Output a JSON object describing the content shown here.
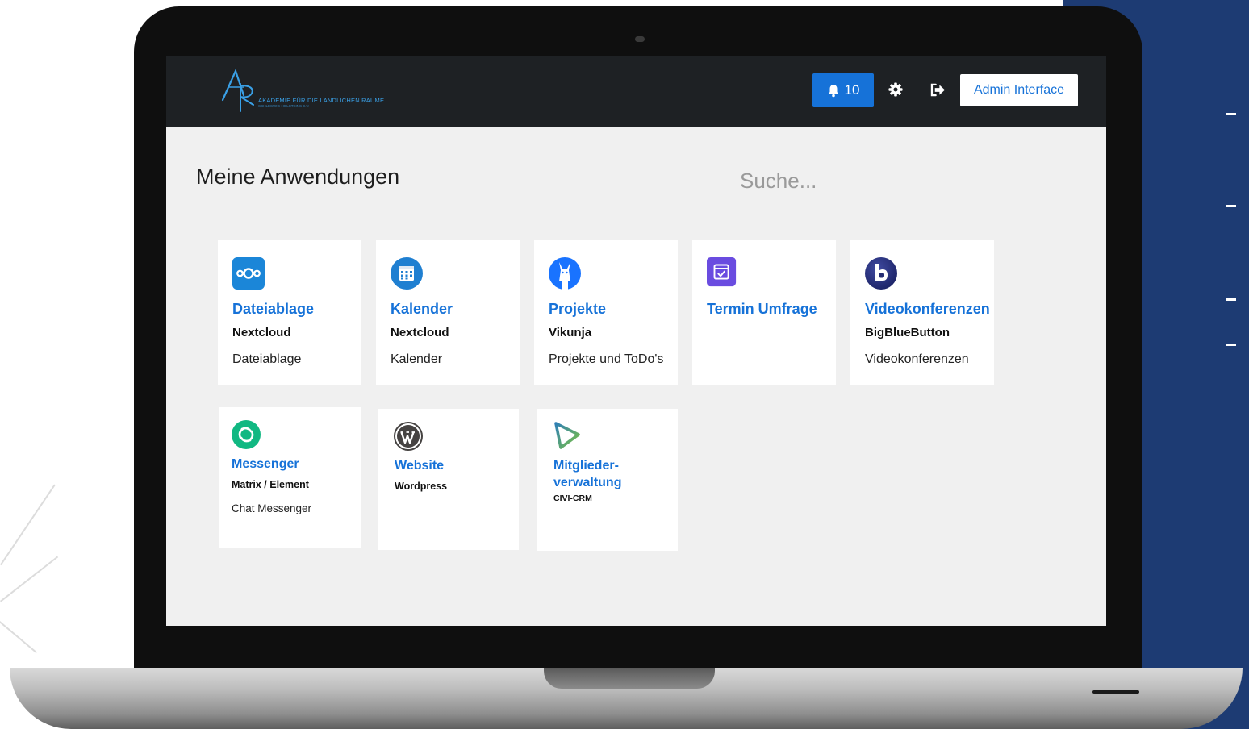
{
  "header": {
    "logo_text": "AKADEMIE FÜR DIE LÄNDLICHEN RÄUME",
    "logo_subtext": "SCHLESWIG-HOLSTEINS E.V.",
    "notification_count": "10",
    "admin_label": "Admin Interface"
  },
  "main": {
    "title": "Meine Anwendungen",
    "search_placeholder": "Suche..."
  },
  "apps": [
    {
      "title": "Dateiablage",
      "subtitle": "Nextcloud",
      "description": "Dateiablage",
      "icon": "nextcloud-icon"
    },
    {
      "title": "Kalender",
      "subtitle": "Nextcloud",
      "description": "Kalender",
      "icon": "calendar-icon"
    },
    {
      "title": "Projekte",
      "subtitle": "Vikunja",
      "description": "Projekte und ToDo's",
      "icon": "vikunja-icon"
    },
    {
      "title": "Termin Umfrage",
      "subtitle": "",
      "description": "",
      "icon": "poll-icon"
    },
    {
      "title": "Videokonferenzen",
      "subtitle": "BigBlueButton",
      "description": "Videokonferenzen",
      "icon": "bigbluebutton-icon"
    },
    {
      "title": "Messenger",
      "subtitle": "Matrix / Element",
      "description": "Chat Messenger",
      "icon": "element-icon"
    },
    {
      "title": "Website",
      "subtitle": "Wordpress",
      "description": "",
      "icon": "wordpress-icon"
    },
    {
      "title_line1": "Mitglieder-",
      "title_line2": "verwaltung",
      "subtitle": "CIVI-CRM",
      "description": "",
      "icon": "civicrm-icon"
    }
  ],
  "colors": {
    "accent": "#1672d8",
    "topbar": "#1e2124",
    "panel": "#1d3b73",
    "search_underline": "#e0604a"
  }
}
